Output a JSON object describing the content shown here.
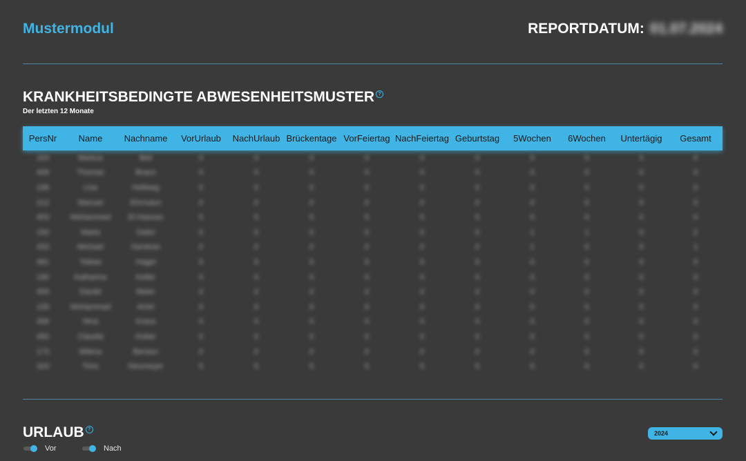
{
  "header": {
    "app_title": "Mustermodul",
    "report_label": "REPORTDATUM:",
    "report_date": "01.07.2024"
  },
  "section_absence": {
    "title": "KRANKHEITSBEDINGTE ABWESENHEITSMUSTER",
    "subtitle": "Der letzten 12 Monate",
    "help_glyph": "?"
  },
  "table": {
    "columns": [
      "PersNr",
      "Name",
      "Nachname",
      "VorUrlaub",
      "NachUrlaub",
      "Brückentage",
      "VorFeiertag",
      "NachFeiertag",
      "Geburtstag",
      "5Wochen",
      "6Wochen",
      "Untertägig",
      "Gesamt"
    ],
    "rows": [
      [
        "103",
        "Markus",
        "Beil",
        "0",
        "0",
        "0",
        "0",
        "0",
        "0",
        "0",
        "0",
        "0",
        "0"
      ],
      [
        "408",
        "Thomas",
        "Braun",
        "0",
        "0",
        "0",
        "0",
        "0",
        "0",
        "0",
        "0",
        "0",
        "0"
      ],
      [
        "198",
        "Lisa",
        "Hellweg",
        "0",
        "0",
        "0",
        "0",
        "0",
        "0",
        "0",
        "0",
        "0",
        "0"
      ],
      [
        "212",
        "Manuel",
        "Ehrmann",
        "0",
        "0",
        "0",
        "0",
        "0",
        "0",
        "0",
        "0",
        "0",
        "0"
      ],
      [
        "403",
        "Mohammed",
        "El-Hassan",
        "0",
        "0",
        "0",
        "0",
        "0",
        "0",
        "0",
        "0",
        "0",
        "0"
      ],
      [
        "150",
        "Maria",
        "Gebri",
        "0",
        "0",
        "0",
        "0",
        "0",
        "0",
        "1",
        "1",
        "0",
        "2"
      ],
      [
        "433",
        "Michael",
        "Gerstner",
        "0",
        "0",
        "0",
        "0",
        "0",
        "0",
        "1",
        "0",
        "0",
        "1"
      ],
      [
        "481",
        "Tobias",
        "Hagel",
        "0",
        "0",
        "0",
        "0",
        "0",
        "0",
        "0",
        "0",
        "0",
        "0"
      ],
      [
        "190",
        "Katharina",
        "Keller",
        "0",
        "0",
        "0",
        "0",
        "0",
        "0",
        "0",
        "0",
        "0",
        "0"
      ],
      [
        "409",
        "Daniel",
        "Meier",
        "0",
        "0",
        "0",
        "0",
        "0",
        "0",
        "0",
        "0",
        "0",
        "0"
      ],
      [
        "128",
        "Mohammad",
        "Amiri",
        "0",
        "0",
        "0",
        "0",
        "0",
        "0",
        "0",
        "0",
        "0",
        "0"
      ],
      [
        "308",
        "Nina",
        "Kraus",
        "0",
        "0",
        "0",
        "0",
        "0",
        "0",
        "0",
        "0",
        "0",
        "0"
      ],
      [
        "450",
        "Claudia",
        "Huber",
        "0",
        "0",
        "0",
        "0",
        "0",
        "0",
        "0",
        "0",
        "0",
        "0"
      ],
      [
        "173",
        "Milena",
        "Berisov",
        "0",
        "0",
        "0",
        "0",
        "0",
        "0",
        "0",
        "0",
        "0",
        "0"
      ],
      [
        "324",
        "Timo",
        "Neumeyer",
        "0",
        "0",
        "0",
        "0",
        "0",
        "0",
        "0",
        "0",
        "0",
        "0"
      ]
    ]
  },
  "section_vacation": {
    "title": "URLAUB",
    "help_glyph": "?",
    "toggles": [
      {
        "label": "Vor",
        "on": true
      },
      {
        "label": "Nach",
        "on": true
      }
    ],
    "year_select": {
      "value": "2024"
    }
  },
  "colors": {
    "accent": "#3fb4e5",
    "background": "#3a3a3a",
    "divider": "#4a86a6"
  },
  "icons": {
    "help": "help-circle-icon",
    "dropdown": "chevron-down-icon"
  }
}
